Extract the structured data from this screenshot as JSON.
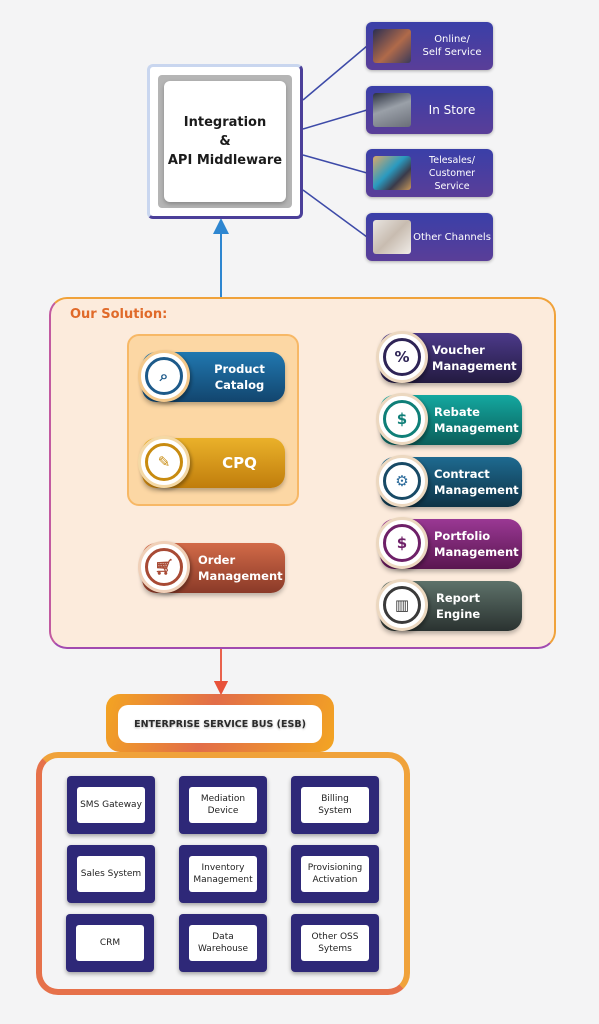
{
  "integration": {
    "title": "Integration\n&\nAPI Middleware"
  },
  "channels": [
    {
      "label": "Online/\nSelf Service",
      "icon": "online-photo"
    },
    {
      "label": "In Store",
      "icon": "store-photo"
    },
    {
      "label": "Telesales/\nCustomer Service",
      "icon": "telesales-photo"
    },
    {
      "label": "Other Channels",
      "icon": "hands-photo"
    }
  ],
  "solution": {
    "title": "Our Solution:",
    "left_modules": [
      {
        "label": "Product\nCatalog",
        "icon": "globe-search-icon",
        "color": "#1d6396"
      },
      {
        "label": "CPQ",
        "icon": "quote-document-icon",
        "color": "#d79a15"
      },
      {
        "label": "Order\nManagement",
        "icon": "shopping-cart-gear-icon",
        "color": "#b4533a"
      }
    ],
    "right_modules": [
      {
        "label": "Voucher\nManagement",
        "icon": "voucher-percent-icon",
        "color": "#3b2a6b"
      },
      {
        "label": "Rebate\nManagement",
        "icon": "dollar-cycle-icon",
        "color": "#10877f"
      },
      {
        "label": "Contract\nManagement",
        "icon": "contract-gear-icon",
        "color": "#1a5472"
      },
      {
        "label": "Portfolio\nManagement",
        "icon": "folder-dollar-icon",
        "color": "#7b2570"
      },
      {
        "label": "Report Engine",
        "icon": "report-chart-icon",
        "color": "#3e4a46"
      }
    ]
  },
  "esb": {
    "title": "ENTERPRISE SERVICE BUS (ESB)"
  },
  "systems": [
    "SMS Gateway",
    "Mediation\nDevice",
    "Billing\nSystem",
    "Sales System",
    "Inventory\nManagement",
    "Provisioning\nActivation",
    "CRM",
    "Data\nWarehouse",
    "Other OSS\nSytems"
  ]
}
